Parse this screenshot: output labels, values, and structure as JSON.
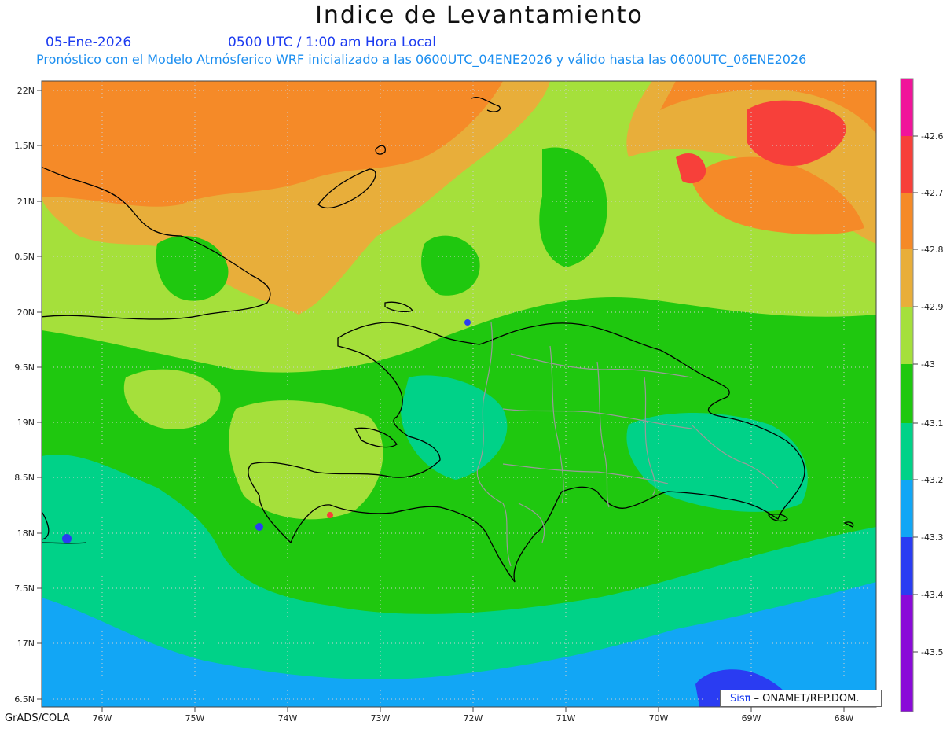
{
  "header": {
    "title": "Indice de Levantamiento",
    "date": "05-Ene-2026",
    "time": "0500 UTC / 1:00 am Hora Local",
    "subtitle": "Pronóstico con el Modelo Atmósferico WRF inicializado a las 0600UTC_04ENE2026 y válido hasta las  0600UTC_06ENE2026"
  },
  "map": {
    "lat_labels": [
      "22N",
      "1.5N",
      "21N",
      "0.5N",
      "20N",
      "9.5N",
      "19N",
      "8.5N",
      "18N",
      "7.5N",
      "17N",
      "6.5N"
    ],
    "lon_labels": [
      "76W",
      "75W",
      "74W",
      "73W",
      "72W",
      "71W",
      "70W",
      "69W",
      "68W"
    ],
    "colors": {
      "orange_red": "#f7403a",
      "orange": "#f58a28",
      "light_orange": "#e8ae3a",
      "yellow_green": "#a5e03b",
      "green": "#1fc80f",
      "teal": "#00d288",
      "light_blue": "#12a6f5",
      "blue": "#2a3cf2",
      "coast": "#000000",
      "provinces": "#9a9a9a"
    }
  },
  "colorbar": {
    "labels": [
      "-42.6",
      "-42.7",
      "-42.8",
      "-42.9",
      "-43",
      "-43.1",
      "-43.2",
      "-43.3",
      "-43.4",
      "-43.5"
    ],
    "colors": [
      "#f0149a",
      "#f7403a",
      "#f58a28",
      "#e8ae3a",
      "#a5e03b",
      "#1fc80f",
      "#00d288",
      "#12a6f5",
      "#2a3cf2",
      "#8a0ad8"
    ]
  },
  "footer": {
    "grads": "GrADS/COLA",
    "credit_logo": "Sisπ",
    "credit_text": "– ONAMET/REP.DOM."
  }
}
